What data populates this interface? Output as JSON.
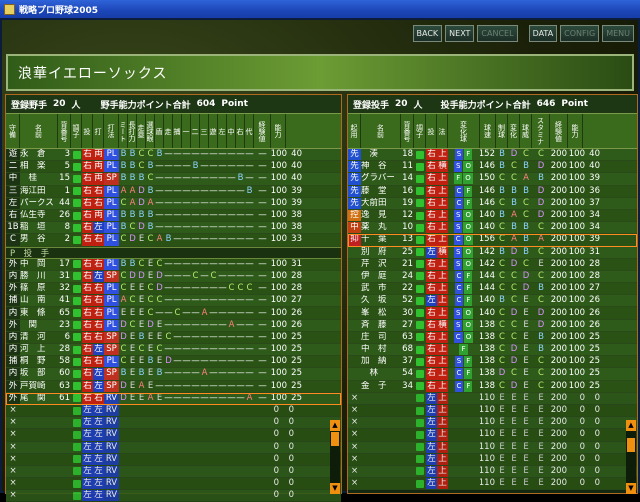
{
  "window": {
    "title": "戦略プロ野球2005"
  },
  "toolbar": {
    "back": "BACK",
    "next": "NEXT",
    "cancel": "CANCEL",
    "data": "DATA",
    "config": "CONFIG",
    "menu": "MENU"
  },
  "team": {
    "name": "浪華イエローソックス"
  },
  "fielders": {
    "header": {
      "label": "登録野手",
      "count": "20",
      "unit": "人",
      "points_label": "野手能力ポイント合計",
      "points": "604",
      "points_unit": "Point"
    },
    "columns": [
      "守備",
      "名前",
      "背番号",
      "調子",
      "投",
      "打",
      "打法",
      "ミート",
      "長打力",
      "走塁",
      "選球眼",
      "盾",
      "走",
      "捕",
      "一",
      "二",
      "三",
      "遊",
      "左",
      "中",
      "右",
      "代",
      "経験値",
      "能力"
    ],
    "rows": [
      {
        "pos": "遊",
        "name": "永　倉",
        "num": "3",
        "sel": "右",
        "bat": "両",
        "st": "PL",
        "a": "B",
        "b": "B",
        "c": "C",
        "d": "C",
        "e": "B",
        "f": "—",
        "g": "—",
        "h": "—",
        "i": "—",
        "j": "—",
        "k": "—",
        "l": "—",
        "m": "—",
        "n": "—",
        "o": "—",
        "p": "—",
        "exp": "100",
        "abil": "40"
      },
      {
        "pos": "二",
        "name": "相　楽",
        "num": "5",
        "sel": "右",
        "bat": "両",
        "st": "PL",
        "a": "B",
        "b": "B",
        "c": "C",
        "d": "B",
        "e": "—",
        "f": "—",
        "g": "—",
        "h": "—",
        "i": "B",
        "j": "—",
        "k": "—",
        "l": "—",
        "m": "—",
        "n": "—",
        "o": "—",
        "p": "—",
        "exp": "100",
        "abil": "40"
      },
      {
        "pos": "中",
        "name": "　桂",
        "num": "15",
        "sel": "右",
        "bat": "両",
        "st": "SP",
        "a": "B",
        "b": "B",
        "c": "B",
        "d": "C",
        "e": "—",
        "f": "—",
        "g": "—",
        "h": "—",
        "i": "—",
        "j": "—",
        "k": "—",
        "l": "—",
        "m": "—",
        "n": "B",
        "o": "—",
        "p": "—",
        "exp": "100",
        "abil": "40"
      },
      {
        "pos": "三",
        "name": "海江田",
        "num": "1",
        "sel": "右",
        "bat": "右",
        "st": "PL",
        "a": "A",
        "b": "A",
        "c": "D",
        "d": "B",
        "e": "—",
        "f": "—",
        "g": "—",
        "h": "—",
        "i": "—",
        "j": "—",
        "k": "—",
        "l": "—",
        "m": "—",
        "n": "—",
        "o": "B",
        "p": "—",
        "exp": "100",
        "abil": "39"
      },
      {
        "pos": "左",
        "name": "パークス",
        "num": "44",
        "sel": "右",
        "bat": "右",
        "st": "PL",
        "a": "C",
        "b": "A",
        "c": "D",
        "d": "A",
        "e": "—",
        "f": "—",
        "g": "—",
        "h": "—",
        "i": "—",
        "j": "—",
        "k": "—",
        "l": "—",
        "m": "—",
        "n": "—",
        "o": "—",
        "p": "—",
        "exp": "100",
        "abil": "39"
      },
      {
        "pos": "右",
        "name": "仏生寺",
        "num": "26",
        "sel": "右",
        "bat": "両",
        "st": "PL",
        "a": "B",
        "b": "B",
        "c": "B",
        "d": "B",
        "e": "—",
        "f": "—",
        "g": "—",
        "h": "—",
        "i": "—",
        "j": "—",
        "k": "—",
        "l": "—",
        "m": "—",
        "n": "—",
        "o": "—",
        "p": "—",
        "exp": "100",
        "abil": "38"
      },
      {
        "pos": "1B",
        "name": "稲　垣",
        "num": "8",
        "sel": "右",
        "bat": "左",
        "st": "PL",
        "a": "B",
        "b": "C",
        "c": "D",
        "d": "B",
        "e": "—",
        "f": "—",
        "g": "—",
        "h": "—",
        "i": "—",
        "j": "—",
        "k": "—",
        "l": "—",
        "m": "—",
        "n": "—",
        "o": "—",
        "p": "—",
        "exp": "100",
        "abil": "38"
      },
      {
        "pos": "C",
        "name": "男　谷",
        "num": "2",
        "sel": "右",
        "bat": "右",
        "st": "PL",
        "a": "C",
        "b": "D",
        "c": "E",
        "d": "C",
        "e": "A",
        "f": "B",
        "g": "—",
        "h": "—",
        "i": "—",
        "j": "—",
        "k": "—",
        "l": "—",
        "m": "—",
        "n": "—",
        "o": "—",
        "p": "—",
        "exp": "100",
        "abil": "33"
      }
    ],
    "pitcher_slot": "P　投　手",
    "bench": [
      {
        "pos": "外",
        "name": "中　岡",
        "num": "17",
        "sel": "右",
        "bat": "右",
        "st": "PL",
        "a": "B",
        "b": "B",
        "c": "C",
        "d": "E",
        "e": "C",
        "f": "—",
        "g": "—",
        "h": "—",
        "i": "—",
        "j": "—",
        "k": "—",
        "l": "—",
        "m": "—",
        "n": "—",
        "o": "—",
        "p": "—",
        "exp": "100",
        "abil": "31"
      },
      {
        "pos": "内",
        "name": "勝　川",
        "num": "31",
        "sel": "右",
        "bat": "左",
        "st": "SP",
        "a": "C",
        "b": "D",
        "c": "D",
        "d": "E",
        "e": "D",
        "f": "—",
        "g": "—",
        "h": "—",
        "i": "C",
        "j": "—",
        "k": "C",
        "l": "—",
        "m": "—",
        "n": "—",
        "o": "—",
        "p": "—",
        "exp": "100",
        "abil": "28"
      },
      {
        "pos": "外",
        "name": "篠　原",
        "num": "32",
        "sel": "右",
        "bat": "右",
        "st": "PL",
        "a": "C",
        "b": "E",
        "c": "E",
        "d": "C",
        "e": "D",
        "f": "—",
        "g": "—",
        "h": "—",
        "i": "—",
        "j": "—",
        "k": "—",
        "l": "—",
        "m": "C",
        "n": "C",
        "o": "C",
        "p": "—",
        "exp": "100",
        "abil": "28"
      },
      {
        "pos": "捕",
        "name": "山　南",
        "num": "41",
        "sel": "右",
        "bat": "右",
        "st": "PL",
        "a": "A",
        "b": "C",
        "c": "E",
        "d": "C",
        "e": "C",
        "f": "—",
        "g": "—",
        "h": "—",
        "i": "—",
        "j": "—",
        "k": "—",
        "l": "—",
        "m": "—",
        "n": "—",
        "o": "—",
        "p": "—",
        "exp": "100",
        "abil": "27"
      },
      {
        "pos": "内",
        "name": "東　條",
        "num": "65",
        "sel": "右",
        "bat": "右",
        "st": "PL",
        "a": "E",
        "b": "E",
        "c": "E",
        "d": "C",
        "e": "—",
        "f": "—",
        "g": "C",
        "h": "—",
        "i": "—",
        "j": "A",
        "k": "—",
        "l": "—",
        "m": "—",
        "n": "—",
        "o": "—",
        "p": "—",
        "exp": "100",
        "abil": "26"
      },
      {
        "pos": "外",
        "name": "　関",
        "num": "23",
        "sel": "右",
        "bat": "右",
        "st": "PL",
        "a": "D",
        "b": "C",
        "c": "E",
        "d": "D",
        "e": "E",
        "f": "—",
        "g": "—",
        "h": "—",
        "i": "—",
        "j": "—",
        "k": "—",
        "l": "—",
        "m": "A",
        "n": "—",
        "o": "—",
        "p": "—",
        "exp": "100",
        "abil": "26"
      },
      {
        "pos": "内",
        "name": "清　河",
        "num": "6",
        "sel": "右",
        "bat": "右",
        "st": "SP",
        "a": "D",
        "b": "E",
        "c": "B",
        "d": "E",
        "e": "E",
        "f": "C",
        "g": "—",
        "h": "—",
        "i": "—",
        "j": "—",
        "k": "—",
        "l": "—",
        "m": "—",
        "n": "—",
        "o": "—",
        "p": "—",
        "exp": "100",
        "abil": "25"
      },
      {
        "pos": "内",
        "name": "河　上",
        "num": "28",
        "sel": "右",
        "bat": "左",
        "st": "SP",
        "a": "C",
        "b": "E",
        "c": "C",
        "d": "E",
        "e": "C",
        "f": "—",
        "g": "—",
        "h": "—",
        "i": "—",
        "j": "—",
        "k": "—",
        "l": "—",
        "m": "—",
        "n": "—",
        "o": "—",
        "p": "—",
        "exp": "100",
        "abil": "25"
      },
      {
        "pos": "捕",
        "name": "桐　野",
        "num": "58",
        "sel": "右",
        "bat": "右",
        "st": "PL",
        "a": "C",
        "b": "E",
        "c": "E",
        "d": "B",
        "e": "E",
        "f": "D",
        "g": "—",
        "h": "—",
        "i": "—",
        "j": "—",
        "k": "—",
        "l": "—",
        "m": "—",
        "n": "—",
        "o": "—",
        "p": "—",
        "exp": "100",
        "abil": "25"
      },
      {
        "pos": "内",
        "name": "坂　部",
        "num": "60",
        "sel": "右",
        "bat": "左",
        "st": "SP",
        "a": "B",
        "b": "E",
        "c": "B",
        "d": "E",
        "e": "B",
        "f": "—",
        "g": "—",
        "h": "—",
        "i": "—",
        "j": "A",
        "k": "—",
        "l": "—",
        "m": "—",
        "n": "—",
        "o": "—",
        "p": "—",
        "exp": "100",
        "abil": "25"
      },
      {
        "pos": "外",
        "name": "戸賀崎",
        "num": "63",
        "sel": "右",
        "bat": "左",
        "st": "SP",
        "a": "D",
        "b": "E",
        "c": "A",
        "d": "E",
        "e": "—",
        "f": "—",
        "g": "—",
        "h": "—",
        "i": "—",
        "j": "—",
        "k": "—",
        "l": "—",
        "m": "—",
        "n": "—",
        "o": "—",
        "p": "—",
        "exp": "100",
        "abil": "25"
      },
      {
        "pos": "外",
        "name": "尾　関",
        "num": "61",
        "sel": "右",
        "bat": "右",
        "st": "RV",
        "a": "D",
        "b": "E",
        "c": "E",
        "d": "A",
        "e": "E",
        "f": "—",
        "g": "—",
        "h": "—",
        "i": "—",
        "j": "—",
        "k": "—",
        "l": "—",
        "m": "—",
        "n": "—",
        "o": "A",
        "p": "—",
        "exp": "100",
        "abil": "25"
      }
    ],
    "empty_rows": 8,
    "empty_pos": "×",
    "empty_bat_l": "左",
    "empty_bat_r": "左",
    "empty_st": "RV",
    "empty_exp": "0",
    "empty_abil": "0"
  },
  "pitchers": {
    "header": {
      "label": "登録投手",
      "count": "20",
      "unit": "人",
      "points_label": "投手能力ポイント合計",
      "points": "646",
      "points_unit": "Point"
    },
    "columns": [
      "起用",
      "名前",
      "背番号",
      "調子",
      "投",
      "法",
      "変化球",
      "球速",
      "制球",
      "変化",
      "球威",
      "スタミナ",
      "経験値",
      "能力"
    ],
    "rows": [
      {
        "role": "先",
        "name": "　湊",
        "num": "18",
        "hand": "右",
        "form": "上",
        "k1": "S",
        "k2": "F",
        "spd": "152",
        "a": "B",
        "b": "D",
        "c": "C",
        "d": "C",
        "sta": "200",
        "exp": "100",
        "abil": "40"
      },
      {
        "role": "先",
        "name": "神　谷",
        "num": "11",
        "hand": "右",
        "form": "横",
        "k1": "S",
        "k2": "O",
        "spd": "146",
        "a": "B",
        "b": "C",
        "c": "B",
        "d": "D",
        "sta": "200",
        "exp": "100",
        "abil": "40"
      },
      {
        "role": "先",
        "name": "グラバー",
        "num": "14",
        "hand": "右",
        "form": "上",
        "k1": "F",
        "k2": "O",
        "spd": "150",
        "a": "C",
        "b": "C",
        "c": "A",
        "d": "B",
        "sta": "200",
        "exp": "100",
        "abil": "39"
      },
      {
        "role": "先",
        "name": "藤　堂",
        "num": "16",
        "hand": "右",
        "form": "上",
        "k1": "C",
        "k2": "F",
        "spd": "146",
        "a": "B",
        "b": "B",
        "c": "B",
        "d": "D",
        "sta": "200",
        "exp": "100",
        "abil": "36"
      },
      {
        "role": "先",
        "name": "大前田",
        "num": "19",
        "hand": "右",
        "form": "上",
        "k1": "C",
        "k2": "F",
        "spd": "146",
        "a": "C",
        "b": "B",
        "c": "C",
        "d": "D",
        "sta": "200",
        "exp": "100",
        "abil": "37"
      },
      {
        "role": "控",
        "name": "逸　見",
        "num": "12",
        "hand": "右",
        "form": "上",
        "k1": "S",
        "k2": "O",
        "spd": "140",
        "a": "B",
        "b": "A",
        "c": "C",
        "d": "D",
        "sta": "200",
        "exp": "100",
        "abil": "34"
      },
      {
        "role": "中",
        "name": "薬　丸",
        "num": "10",
        "hand": "右",
        "form": "上",
        "k1": "S",
        "k2": "O",
        "spd": "140",
        "a": "C",
        "b": "B",
        "c": "B",
        "d": "C",
        "sta": "200",
        "exp": "100",
        "abil": "34"
      },
      {
        "role": "抑",
        "name": "千　葉",
        "num": "13",
        "hand": "右",
        "form": "上",
        "k1": "C",
        "k2": "O",
        "spd": "156",
        "a": "C",
        "b": "A",
        "c": "B",
        "d": "A",
        "sta": "200",
        "exp": "100",
        "abil": "39"
      },
      {
        "role": "",
        "name": "別　府",
        "num": "25",
        "hand": "左",
        "form": "横",
        "k1": "S",
        "k2": "O",
        "spd": "142",
        "a": "B",
        "b": "D",
        "c": "B",
        "d": "C",
        "sta": "200",
        "exp": "100",
        "abil": "31"
      },
      {
        "role": "",
        "name": "芹　沢",
        "num": "21",
        "hand": "右",
        "form": "上",
        "k1": "S",
        "k2": "O",
        "spd": "142",
        "a": "C",
        "b": "D",
        "c": "C",
        "d": "E",
        "sta": "200",
        "exp": "100",
        "abil": "28"
      },
      {
        "role": "",
        "name": "伊　庭",
        "num": "24",
        "hand": "右",
        "form": "上",
        "k1": "C",
        "k2": "F",
        "spd": "144",
        "a": "C",
        "b": "C",
        "c": "D",
        "d": "C",
        "sta": "200",
        "exp": "100",
        "abil": "28"
      },
      {
        "role": "",
        "name": "武　市",
        "num": "22",
        "hand": "右",
        "form": "上",
        "k1": "C",
        "k2": "F",
        "spd": "144",
        "a": "C",
        "b": "C",
        "c": "D",
        "d": "B",
        "sta": "200",
        "exp": "100",
        "abil": "27"
      },
      {
        "role": "",
        "name": "久　坂",
        "num": "52",
        "hand": "左",
        "form": "上",
        "k1": "C",
        "k2": "F",
        "spd": "140",
        "a": "B",
        "b": "C",
        "c": "E",
        "d": "C",
        "sta": "200",
        "exp": "100",
        "abil": "26"
      },
      {
        "role": "",
        "name": "峯　松",
        "num": "30",
        "hand": "右",
        "form": "上",
        "k1": "S",
        "k2": "O",
        "spd": "140",
        "a": "C",
        "b": "D",
        "c": "E",
        "d": "D",
        "sta": "200",
        "exp": "100",
        "abil": "26"
      },
      {
        "role": "",
        "name": "斉　藤",
        "num": "27",
        "hand": "右",
        "form": "横",
        "k1": "S",
        "k2": "O",
        "spd": "138",
        "a": "C",
        "b": "C",
        "c": "E",
        "d": "D",
        "sta": "200",
        "exp": "100",
        "abil": "26"
      },
      {
        "role": "",
        "name": "庄　司",
        "num": "63",
        "hand": "右",
        "form": "上",
        "k1": "C",
        "k2": "O",
        "spd": "138",
        "a": "C",
        "b": "C",
        "c": "E",
        "d": "B",
        "sta": "200",
        "exp": "100",
        "abil": "25"
      },
      {
        "role": "",
        "name": "中　村",
        "num": "68",
        "hand": "右",
        "form": "上",
        "k1": "F",
        "k2": "",
        "spd": "138",
        "a": "C",
        "b": "D",
        "c": "E",
        "d": "B",
        "sta": "200",
        "exp": "100",
        "abil": "25"
      },
      {
        "role": "",
        "name": "加　納",
        "num": "37",
        "hand": "右",
        "form": "上",
        "k1": "S",
        "k2": "F",
        "spd": "138",
        "a": "C",
        "b": "D",
        "c": "E",
        "d": "C",
        "sta": "200",
        "exp": "100",
        "abil": "25"
      },
      {
        "role": "",
        "name": "　林",
        "num": "54",
        "hand": "右",
        "form": "上",
        "k1": "C",
        "k2": "F",
        "spd": "138",
        "a": "D",
        "b": "C",
        "c": "E",
        "d": "C",
        "sta": "200",
        "exp": "100",
        "abil": "25"
      },
      {
        "role": "",
        "name": "金　子",
        "num": "34",
        "hand": "右",
        "form": "上",
        "k1": "C",
        "k2": "F",
        "spd": "138",
        "a": "C",
        "b": "D",
        "c": "E",
        "d": "C",
        "sta": "200",
        "exp": "100",
        "abil": "25"
      }
    ],
    "empty_rows": 8,
    "empty_pos": "×",
    "empty_hand": "左",
    "empty_form": "上",
    "empty_spd": "110",
    "empty_grade": "E",
    "empty_sta": "200",
    "empty_exp": "0",
    "empty_abil": "0"
  },
  "colors": {
    "accent": "#f09010",
    "panel_border": "#b06a20",
    "header_bg": "#4a7c24"
  }
}
